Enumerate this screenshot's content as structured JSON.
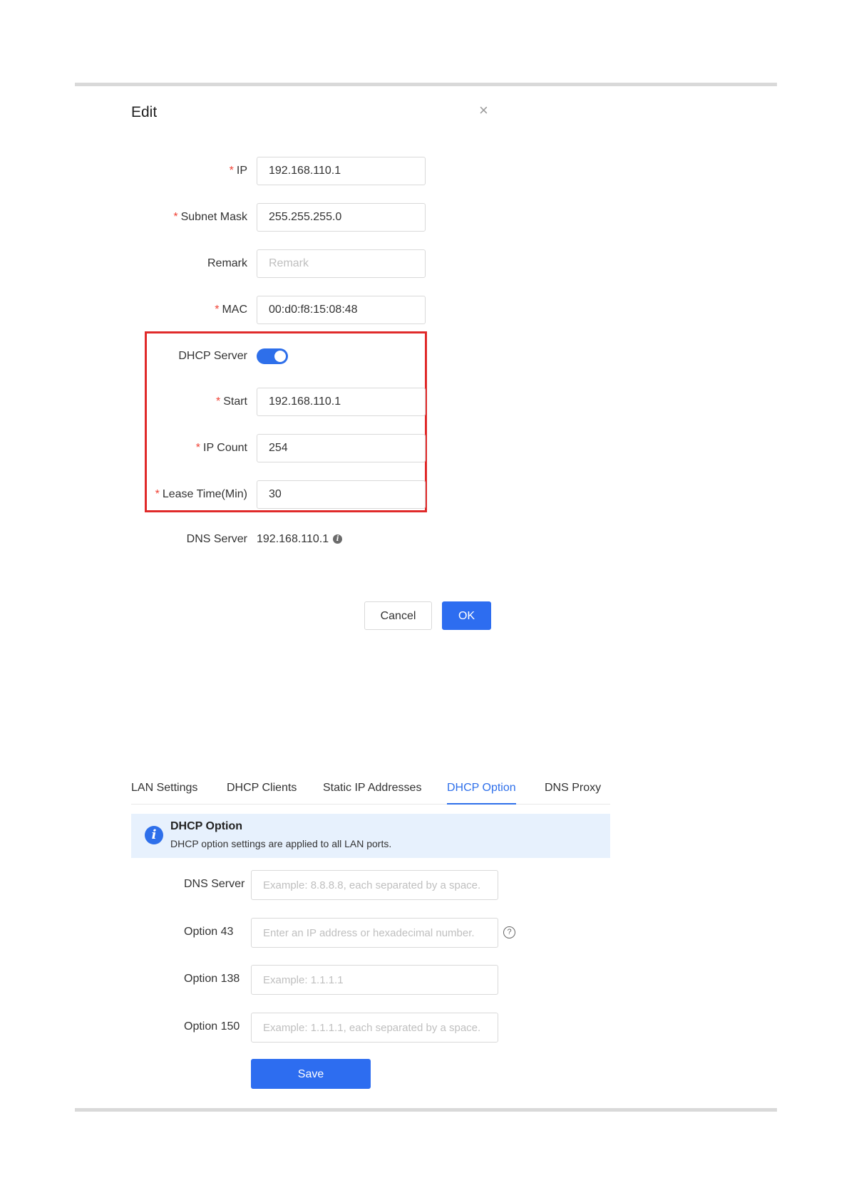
{
  "dialog": {
    "title": "Edit",
    "close_glyph": "×",
    "fields": {
      "ip": {
        "label": "IP",
        "value": "192.168.110.1"
      },
      "subnet_mask": {
        "label": "Subnet Mask",
        "value": "255.255.255.0"
      },
      "remark": {
        "label": "Remark",
        "value": "",
        "placeholder": "Remark"
      },
      "mac": {
        "label": "MAC",
        "value": "00:d0:f8:15:08:48"
      },
      "dhcp_server": {
        "label": "DHCP Server",
        "enabled": true
      },
      "start": {
        "label": "Start",
        "value": "192.168.110.1"
      },
      "ip_count": {
        "label": "IP Count",
        "value": "254"
      },
      "lease_time": {
        "label": "Lease Time(Min)",
        "value": "30"
      },
      "dns_server": {
        "label": "DNS Server",
        "value": "192.168.110.1"
      }
    },
    "required_mark": "*",
    "info_glyph": "i",
    "cancel_label": "Cancel",
    "ok_label": "OK",
    "highlight_color": "#e02a2a"
  },
  "dhcp_option": {
    "tabs": [
      {
        "label": "LAN Settings",
        "active": false
      },
      {
        "label": "DHCP Clients",
        "active": false
      },
      {
        "label": "Static IP Addresses",
        "active": false
      },
      {
        "label": "DHCP Option",
        "active": true
      },
      {
        "label": "DNS Proxy",
        "active": false
      }
    ],
    "notice": {
      "icon": "info-icon",
      "icon_glyph": "i",
      "title": "DHCP Option",
      "description": "DHCP option settings are applied to all LAN ports."
    },
    "fields": {
      "dns_server": {
        "label": "DNS Server",
        "value": "",
        "placeholder": "Example: 8.8.8.8, each separated by a space."
      },
      "option_43": {
        "label": "Option 43",
        "value": "",
        "placeholder": "Enter an IP address or hexadecimal number."
      },
      "option_138": {
        "label": "Option 138",
        "value": "",
        "placeholder": "Example: 1.1.1.1"
      },
      "option_150": {
        "label": "Option 150",
        "value": "",
        "placeholder": "Example: 1.1.1.1, each separated by a space."
      }
    },
    "help_glyph": "?",
    "save_label": "Save",
    "accent_color": "#2e6fea"
  }
}
